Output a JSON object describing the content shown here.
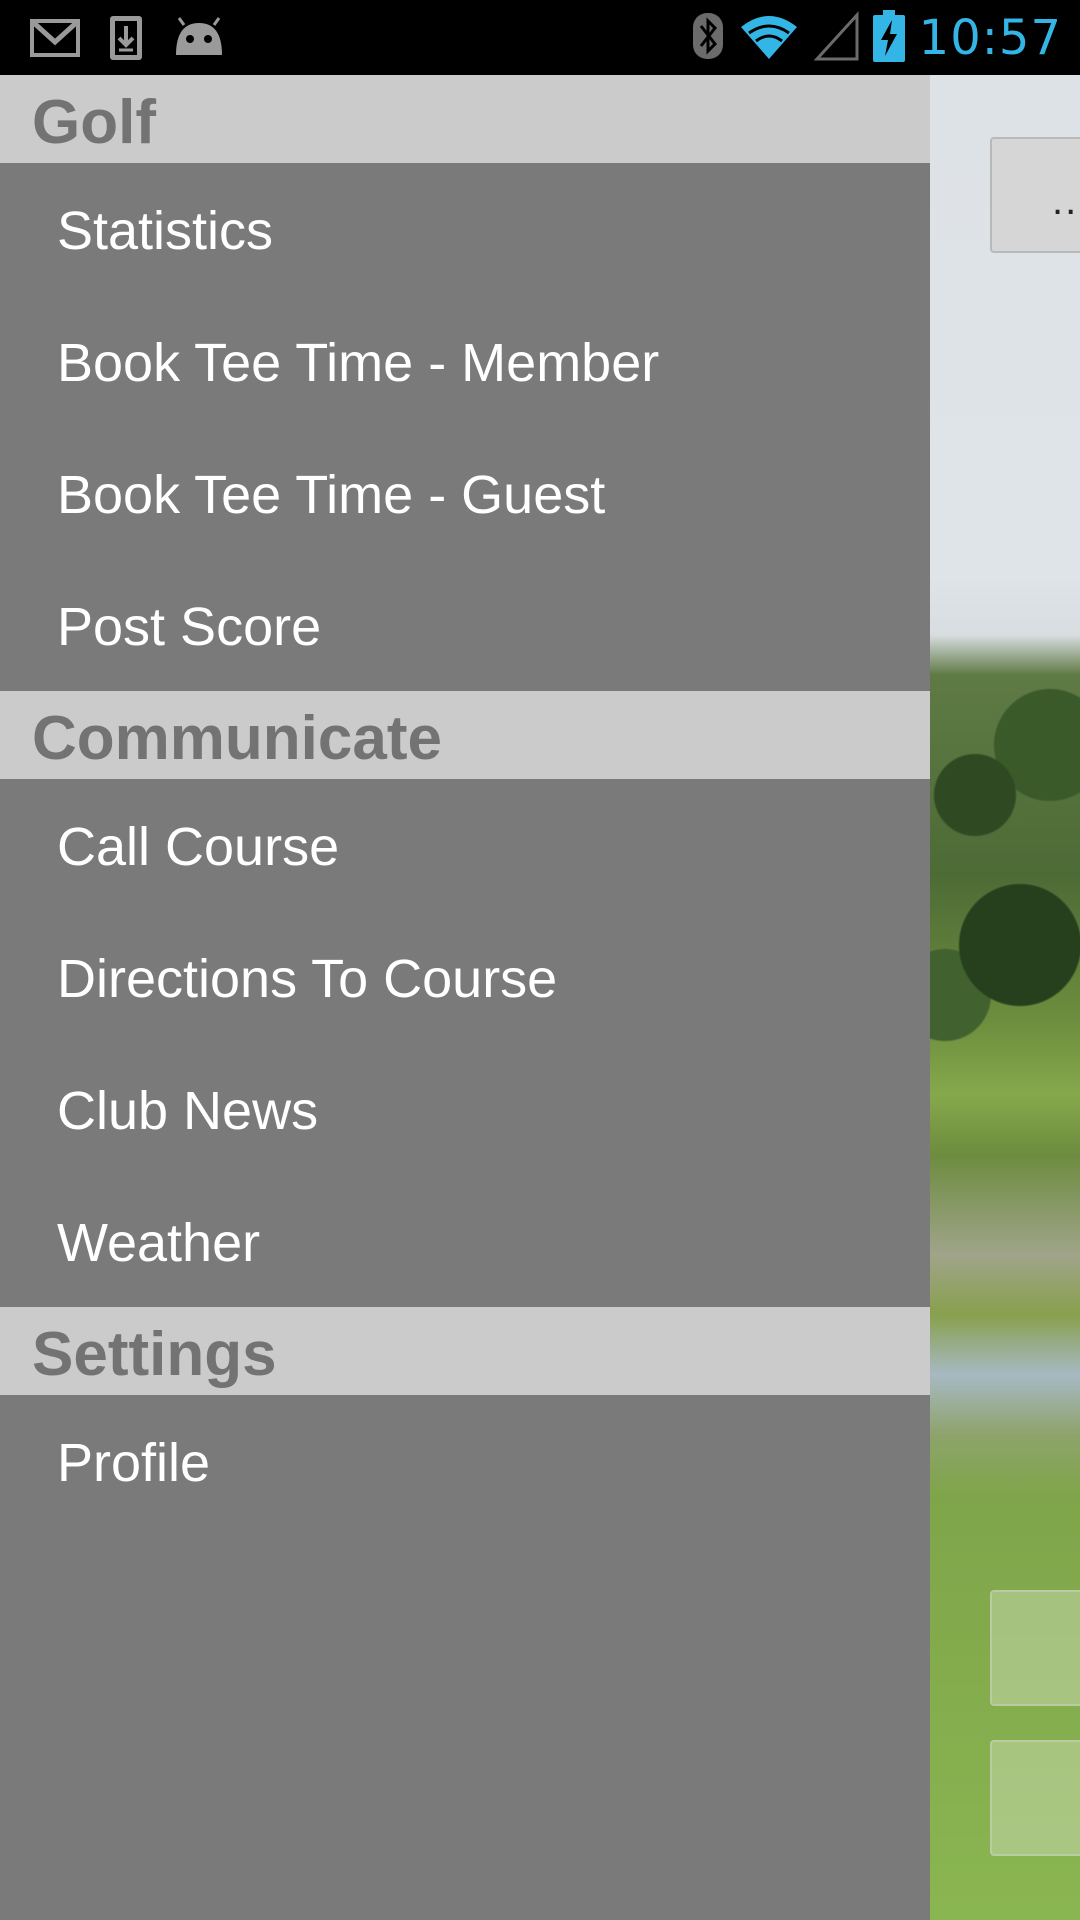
{
  "status_bar": {
    "time": "10:57",
    "left_icons": [
      "gmail-icon",
      "download-icon",
      "android-icon"
    ],
    "right_icons": [
      "bluetooth-icon",
      "wifi-icon",
      "signal-icon",
      "battery-charging-icon"
    ],
    "clock_color": "#33b5e5"
  },
  "drawer": {
    "sections": [
      {
        "title": "Golf",
        "items": [
          "Statistics",
          "Book Tee Time - Member",
          "Book Tee Time - Guest",
          "Post Score"
        ]
      },
      {
        "title": "Communicate",
        "items": [
          "Call Course",
          "Directions To Course",
          "Club News",
          "Weather"
        ]
      },
      {
        "title": "Settings",
        "items": [
          "Profile"
        ]
      }
    ],
    "colors": {
      "background": "#7a7a7a",
      "header_background": "#cbcbcb",
      "header_text": "#737373",
      "item_text": "#ffffff"
    }
  },
  "background_app": {
    "button_label": ".."
  }
}
